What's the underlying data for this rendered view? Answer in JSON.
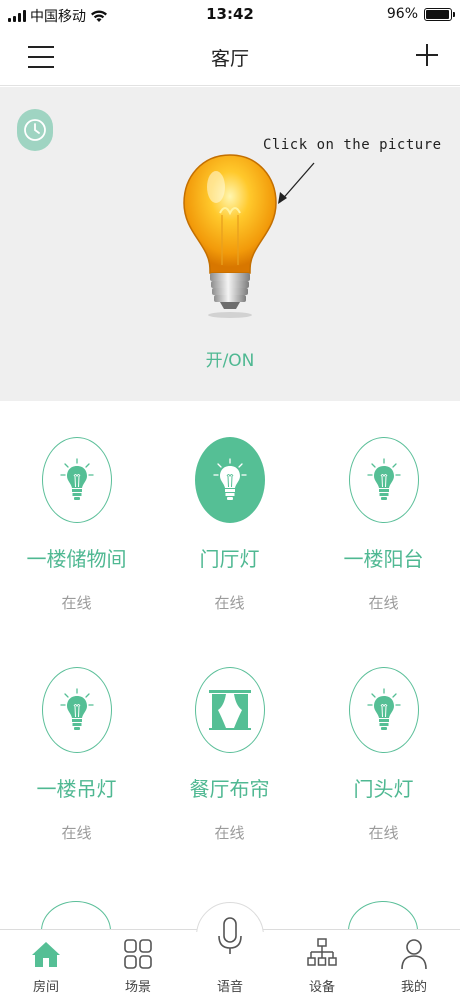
{
  "status_bar": {
    "carrier": "中国移动",
    "time": "13:42",
    "battery_percent": "96%",
    "battery_level": 0.96
  },
  "header": {
    "title": "客厅",
    "menu_icon": "menu-icon",
    "add_icon": "plus-icon"
  },
  "hero": {
    "timer_icon": "clock-icon",
    "hint": "Click on the picture",
    "power_label": "开/ON",
    "bulb_state": "on"
  },
  "devices": [
    {
      "name": "一楼储物间",
      "status": "在线",
      "icon": "bulb-icon",
      "active": false
    },
    {
      "name": "门厅灯",
      "status": "在线",
      "icon": "bulb-icon",
      "active": true
    },
    {
      "name": "一楼阳台",
      "status": "在线",
      "icon": "bulb-icon",
      "active": false
    },
    {
      "name": "一楼吊灯",
      "status": "在线",
      "icon": "bulb-icon",
      "active": false
    },
    {
      "name": "餐厅布帘",
      "status": "在线",
      "icon": "curtain-icon",
      "active": false
    },
    {
      "name": "门头灯",
      "status": "在线",
      "icon": "bulb-icon",
      "active": false
    }
  ],
  "tabs": [
    {
      "label": "房间",
      "icon": "home-icon",
      "active": true
    },
    {
      "label": "场景",
      "icon": "grid-icon",
      "active": false
    },
    {
      "label": "语音",
      "icon": "microphone-icon",
      "active": false
    },
    {
      "label": "设备",
      "icon": "device-tree-icon",
      "active": false
    },
    {
      "label": "我的",
      "icon": "user-icon",
      "active": false
    }
  ],
  "colors": {
    "accent": "#4fb892",
    "hero_bg": "#efefef",
    "status_gray": "#9b9b9b"
  }
}
